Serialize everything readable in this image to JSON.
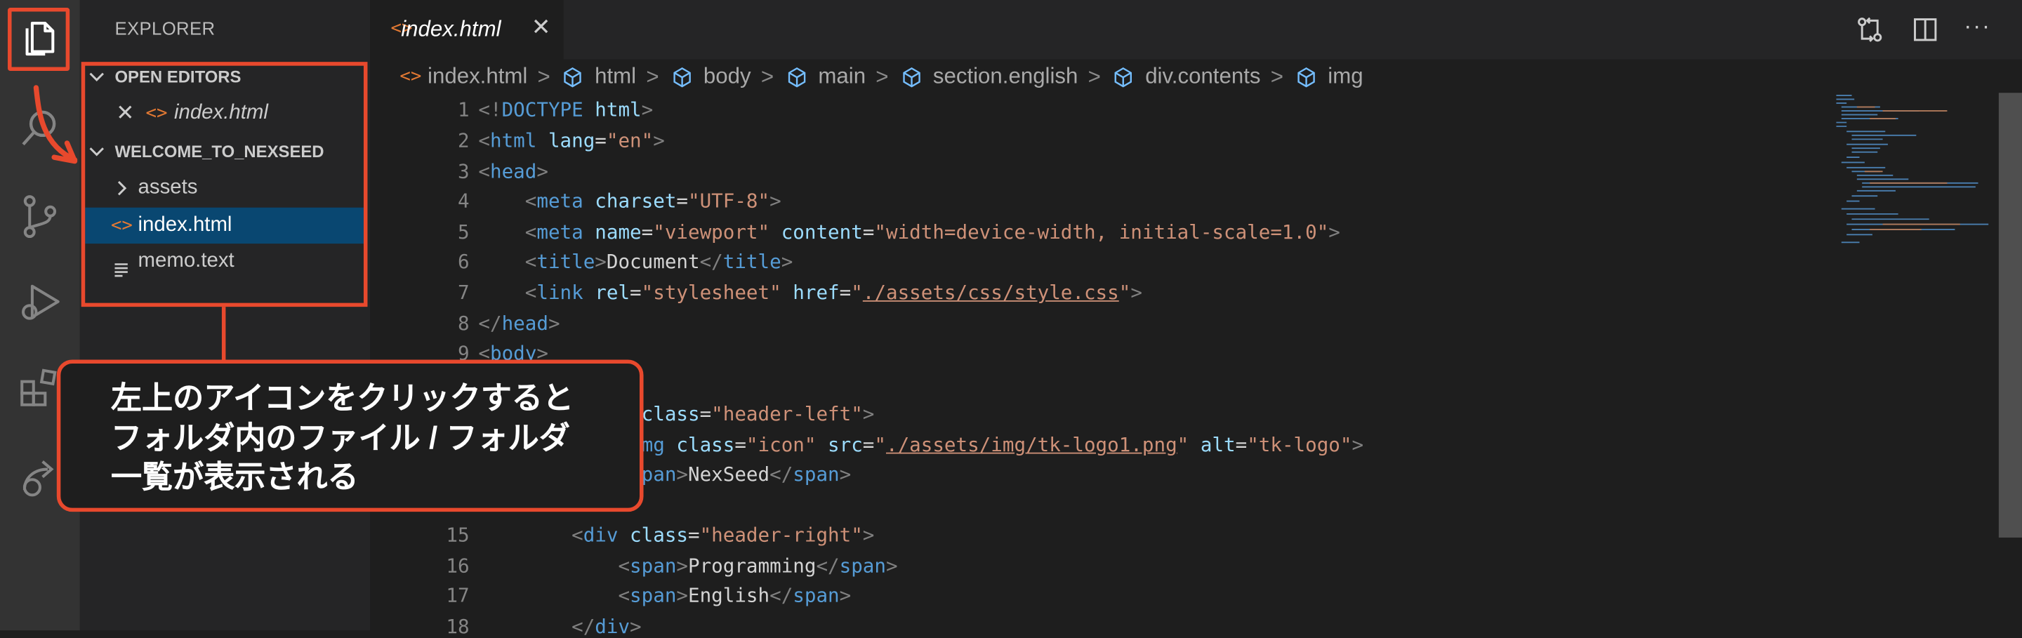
{
  "sidebar": {
    "title": "EXPLORER",
    "open_editors": {
      "header": "OPEN EDITORS",
      "items": [
        {
          "label": "index.html",
          "icon": "html-code-icon"
        }
      ]
    },
    "workspace": {
      "header": "WELCOME_TO_NEXSEED",
      "items": [
        {
          "label": "assets",
          "icon": "folder-chevron-icon"
        },
        {
          "label": "index.html",
          "icon": "html-code-icon"
        },
        {
          "label": "memo.text",
          "icon": "text-file-icon"
        }
      ]
    }
  },
  "tab": {
    "label": "index.html",
    "icon": "html-code-icon"
  },
  "breadcrumb": {
    "items": [
      "index.html",
      "html",
      "body",
      "main",
      "section.english",
      "div.contents",
      "img"
    ]
  },
  "editor": {
    "line_numbers": [
      "1",
      "2",
      "3",
      "4",
      "5",
      "6",
      "7",
      "8",
      "9",
      "15",
      "16",
      "17",
      "18"
    ]
  },
  "callout": {
    "lines": [
      "左上のアイコンをクリックすると",
      "フォルダ内のファイル / フォルダ",
      "一覧が表示される"
    ]
  },
  "colors": {
    "activity_bar": "#333333",
    "sidebar": "#252526",
    "editor": "#1e1e1e",
    "selection": "#094771",
    "annotation": "#e8492d",
    "html_icon": "#e37933"
  }
}
